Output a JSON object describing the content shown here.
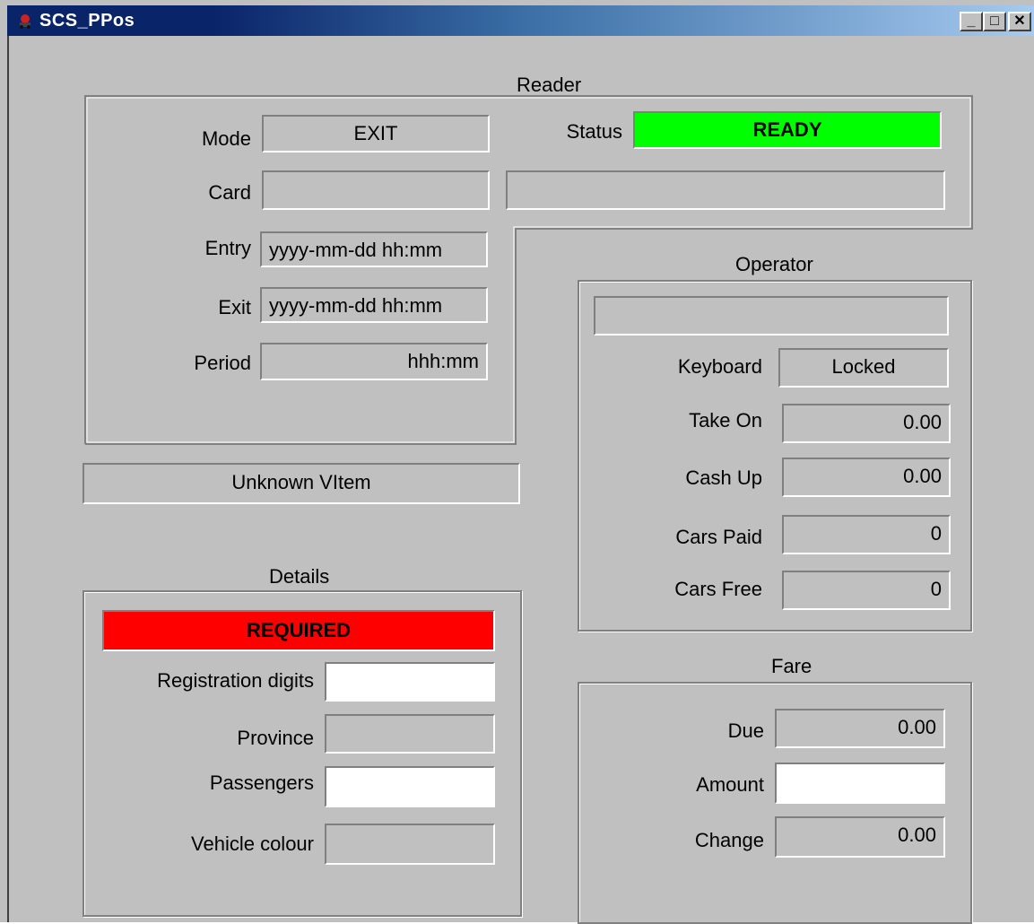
{
  "window": {
    "title": "SCS_PPos",
    "minimize_glyph": "_",
    "maximize_glyph": "□",
    "close_glyph": "✕",
    "icon": "app-icon"
  },
  "reader": {
    "group_label": "Reader",
    "mode_label": "Mode",
    "mode_value": "EXIT",
    "status_label": "Status",
    "status_value": "READY",
    "card_label": "Card",
    "card_value": "",
    "card_value2": "",
    "entry_label": "Entry",
    "entry_value": "yyyy-mm-dd hh:mm",
    "exit_label": "Exit",
    "exit_value": "yyyy-mm-dd hh:mm",
    "period_label": "Period",
    "period_value": "hhh:mm"
  },
  "vitem": {
    "text": "Unknown VItem"
  },
  "operator": {
    "group_label": "Operator",
    "name_value": "",
    "keyboard_label": "Keyboard",
    "keyboard_value": "Locked",
    "take_on_label": "Take On",
    "take_on_value": "0.00",
    "cash_up_label": "Cash Up",
    "cash_up_value": "0.00",
    "cars_paid_label": "Cars Paid",
    "cars_paid_value": "0",
    "cars_free_label": "Cars Free",
    "cars_free_value": "0"
  },
  "details": {
    "group_label": "Details",
    "required_text": "REQUIRED",
    "registration_label": "Registration digits",
    "registration_value": "",
    "province_label": "Province",
    "province_value": "",
    "passengers_label": "Passengers",
    "passengers_value": "",
    "vehicle_colour_label": "Vehicle colour",
    "vehicle_colour_value": ""
  },
  "fare": {
    "group_label": "Fare",
    "due_label": "Due",
    "due_value": "0.00",
    "amount_label": "Amount",
    "amount_value": "",
    "change_label": "Change",
    "change_value": "0.00"
  },
  "colors": {
    "ready": "#00ff00",
    "required": "#ff0000",
    "titlebar": "#0a246a",
    "window_bg": "#c0c0c0"
  }
}
